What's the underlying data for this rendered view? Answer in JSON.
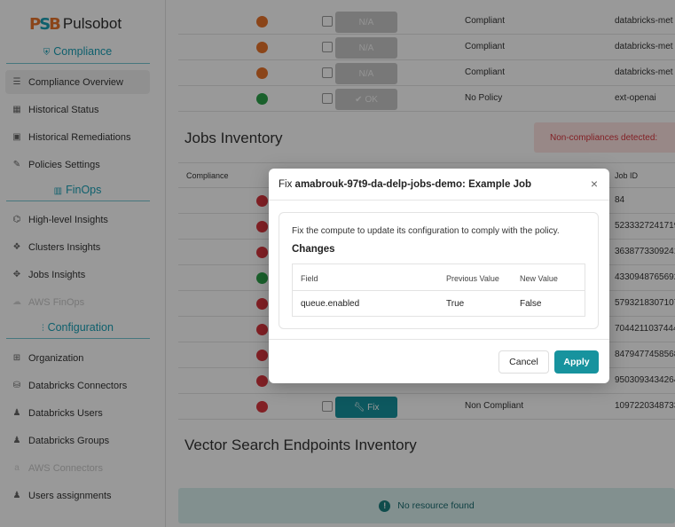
{
  "brand": {
    "name": "Pulsobot"
  },
  "sidebar": {
    "sections": [
      {
        "title": "Compliance",
        "icon": "shield-check-icon"
      },
      {
        "title": "FinOps",
        "icon": "bar-chart-icon"
      },
      {
        "title": "Configuration",
        "icon": "sliders-icon"
      }
    ],
    "items": [
      {
        "label": "Compliance Overview",
        "icon": "list-icon",
        "active": true
      },
      {
        "label": "Historical Status",
        "icon": "calendar-icon"
      },
      {
        "label": "Historical Remediations",
        "icon": "calendar-check-icon"
      },
      {
        "label": "Policies Settings",
        "icon": "edit-icon"
      },
      {
        "label": "High-level Insights",
        "icon": "insights-icon"
      },
      {
        "label": "Clusters Insights",
        "icon": "cubes-icon"
      },
      {
        "label": "Jobs Insights",
        "icon": "arrows-icon"
      },
      {
        "label": "AWS FinOps",
        "icon": "cloud-icon",
        "disabled": true
      },
      {
        "label": "Organization",
        "icon": "sitemap-icon"
      },
      {
        "label": "Databricks Connectors",
        "icon": "database-icon"
      },
      {
        "label": "Databricks Users",
        "icon": "user-gear-icon"
      },
      {
        "label": "Databricks Groups",
        "icon": "users-icon"
      },
      {
        "label": "AWS Connectors",
        "icon": "aws-icon",
        "disabled": true
      },
      {
        "label": "Users assignments",
        "icon": "users-assign-icon"
      }
    ]
  },
  "top_table": {
    "rows": [
      {
        "status_color": "orange",
        "action": "N/A",
        "compliance": "Compliant",
        "id": "databricks-met"
      },
      {
        "status_color": "orange",
        "action": "N/A",
        "compliance": "Compliant",
        "id": "databricks-met"
      },
      {
        "status_color": "orange",
        "action": "N/A",
        "compliance": "Compliant",
        "id": "databricks-met"
      },
      {
        "status_color": "green",
        "action": "OK",
        "compliance": "No Policy",
        "id": "ext-openai"
      }
    ]
  },
  "jobs": {
    "title": "Jobs Inventory",
    "alert": "Non-compliances detected:",
    "columns": {
      "compliance": "Compliance",
      "job_id": "Job ID"
    },
    "rows": [
      {
        "status_color": "red",
        "id": "84"
      },
      {
        "status_color": "red",
        "id": "5233327241719"
      },
      {
        "status_color": "red",
        "id": "3638773309241"
      },
      {
        "status_color": "green",
        "id": "4330948765692"
      },
      {
        "status_color": "red",
        "id": "5793218307107"
      },
      {
        "status_color": "red",
        "id": "7044211037444"
      },
      {
        "status_color": "red",
        "id": "8479477458568"
      },
      {
        "status_color": "red",
        "id": "9503093434264"
      },
      {
        "status_color": "red",
        "action": "Fix",
        "compliance": "Non Compliant",
        "id": "1097220348733"
      }
    ]
  },
  "vector": {
    "title": "Vector Search Endpoints Inventory",
    "empty": "No resource found"
  },
  "modal": {
    "title_prefix": "Fix",
    "title_name": "amabrouk-97t9-da-delp-jobs-demo: Example Job",
    "description": "Fix the compute to update its configuration to comply with the policy.",
    "changes_label": "Changes",
    "columns": {
      "field": "Field",
      "previous": "Previous Value",
      "new": "New Value"
    },
    "row": {
      "field": "queue.enabled",
      "previous": "True",
      "new": "False"
    },
    "cancel": "Cancel",
    "apply": "Apply",
    "close": "×"
  },
  "colors": {
    "accent": "#17939e",
    "orange": "#e8742a",
    "green": "#2ca24a",
    "red": "#d9363e"
  }
}
